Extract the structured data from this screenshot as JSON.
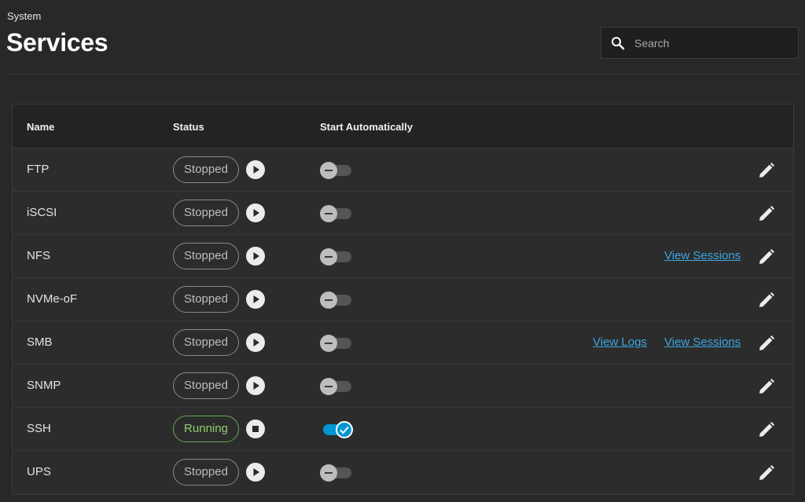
{
  "header": {
    "breadcrumb": "System",
    "title": "Services",
    "search": {
      "placeholder": "Search",
      "value": ""
    }
  },
  "table": {
    "columns": [
      "Name",
      "Status",
      "Start Automatically"
    ],
    "rows": [
      {
        "name": "FTP",
        "status": "Stopped",
        "running": false,
        "start_automatically": false,
        "links": []
      },
      {
        "name": "iSCSI",
        "status": "Stopped",
        "running": false,
        "start_automatically": false,
        "links": []
      },
      {
        "name": "NFS",
        "status": "Stopped",
        "running": false,
        "start_automatically": false,
        "links": [
          "View Sessions"
        ]
      },
      {
        "name": "NVMe-oF",
        "status": "Stopped",
        "running": false,
        "start_automatically": false,
        "links": []
      },
      {
        "name": "SMB",
        "status": "Stopped",
        "running": false,
        "start_automatically": false,
        "links": [
          "View Logs",
          "View Sessions"
        ]
      },
      {
        "name": "SNMP",
        "status": "Stopped",
        "running": false,
        "start_automatically": false,
        "links": []
      },
      {
        "name": "SSH",
        "status": "Running",
        "running": true,
        "start_automatically": true,
        "links": []
      },
      {
        "name": "UPS",
        "status": "Stopped",
        "running": false,
        "start_automatically": false,
        "links": []
      }
    ]
  },
  "icons": {
    "search": "search-icon",
    "start": "play-icon",
    "stop": "stop-icon",
    "edit": "pencil-icon",
    "toggle_on": "check-icon",
    "toggle_off": "minus-icon"
  },
  "colors": {
    "background": "#282828",
    "running": "#8fd16a",
    "link": "#3ba7e0",
    "toggle_on": "#0095d5"
  }
}
